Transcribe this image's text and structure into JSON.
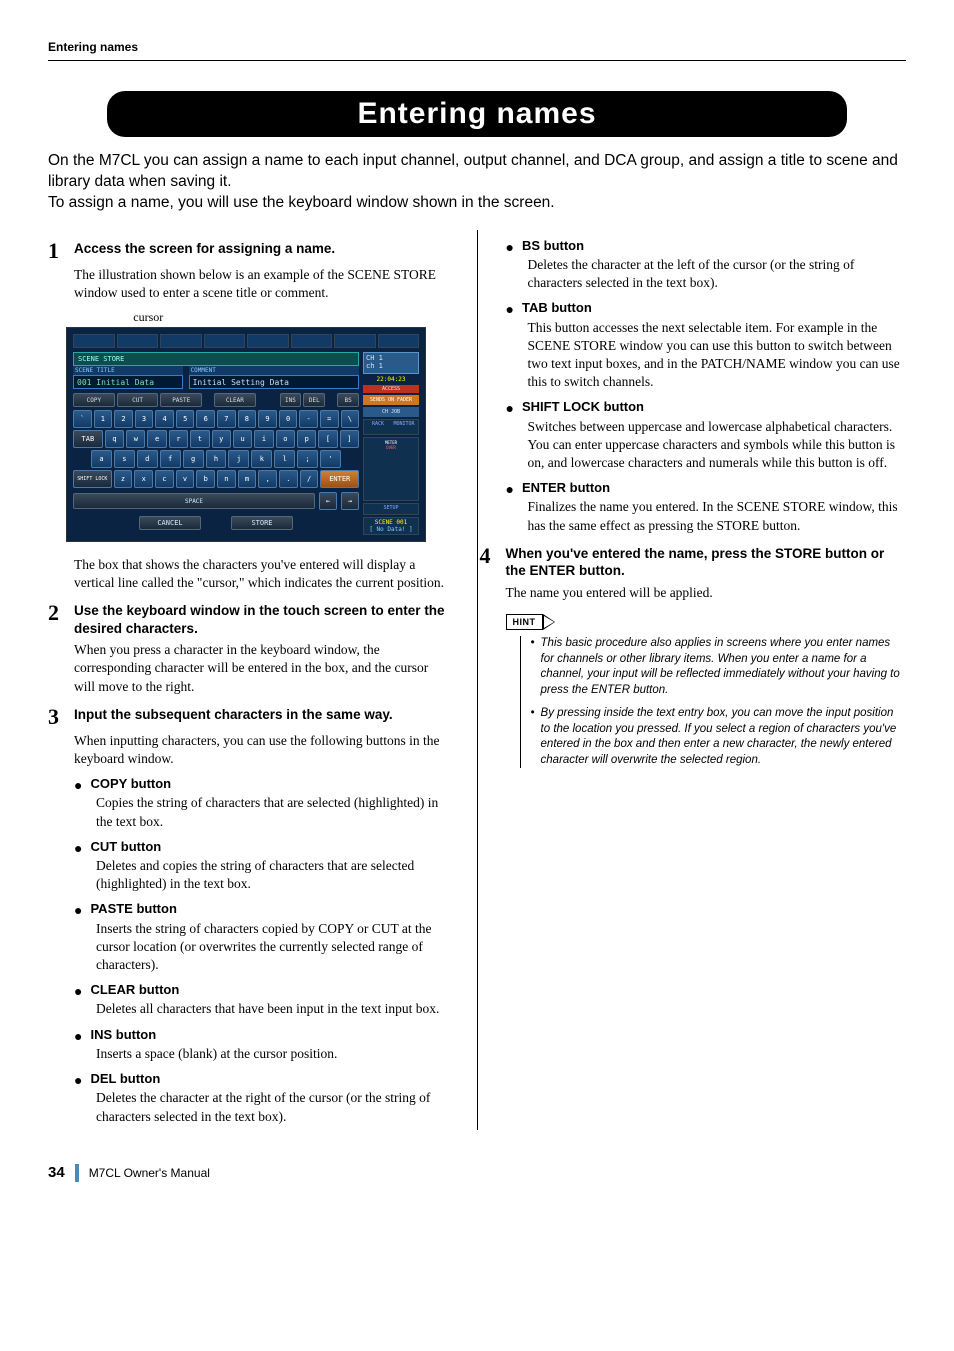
{
  "header": {
    "running_title": "Entering names"
  },
  "title": "Entering names",
  "intro": "On the M7CL you can assign a name to each input channel, output channel, and DCA group, and assign a title to scene and library data when saving it.\nTo assign a name, you will use the keyboard window shown in the screen.",
  "steps": {
    "s1": {
      "num": "1",
      "title": "Access the screen for assigning a name.",
      "body": "The illustration shown below is an example of the SCENE STORE window used to enter a scene title or comment.",
      "cursor_label": "cursor",
      "after": "The box that shows the characters you've entered will display a vertical line called the \"cursor,\" which indicates the current position."
    },
    "s2": {
      "num": "2",
      "title": "Use the keyboard window in the touch screen to enter the desired characters.",
      "body": "When you press a character in the keyboard window, the corresponding character will be entered in the box, and the cursor will move to the right."
    },
    "s3": {
      "num": "3",
      "title": "Input the subsequent characters in the same way.",
      "body": "When inputting characters, you can use the following buttons in the keyboard window."
    },
    "s4": {
      "num": "4",
      "title": "When you've entered the name, press the STORE button or the ENTER button.",
      "body": "The name you entered will be applied."
    }
  },
  "buttons": {
    "copy": {
      "t": "COPY button",
      "b": "Copies the string of characters that are selected (highlighted) in the text box."
    },
    "cut": {
      "t": "CUT button",
      "b": "Deletes and copies the string of characters that are selected (highlighted) in the text box."
    },
    "paste": {
      "t": "PASTE button",
      "b": "Inserts the string of characters copied by COPY or CUT at the cursor location (or overwrites the currently selected range of characters)."
    },
    "clear": {
      "t": "CLEAR button",
      "b": "Deletes all characters that have been input in the text input box."
    },
    "ins": {
      "t": "INS button",
      "b": "Inserts a space (blank) at the cursor position."
    },
    "del": {
      "t": "DEL button",
      "b": "Deletes the character at the right of the cursor (or the string of characters selected in the text box)."
    },
    "bs": {
      "t": "BS button",
      "b": "Deletes the character at the left of the cursor (or the string of characters selected in the text box)."
    },
    "tab": {
      "t": "TAB button",
      "b": "This button accesses the next selectable item. For example in the SCENE STORE window you can use this button to switch between two text input boxes, and in the PATCH/NAME window you can use this to switch channels."
    },
    "shift": {
      "t": "SHIFT LOCK button",
      "b": "Switches between uppercase and lowercase alphabetical characters. You can enter uppercase characters and symbols while this button is on, and lowercase characters and numerals while this button is off."
    },
    "enter": {
      "t": "ENTER button",
      "b": "Finalizes the name you entered. In the SCENE STORE window, this has the same effect as pressing the STORE button."
    }
  },
  "hint": {
    "label": "HINT",
    "h1": "This basic procedure also applies in screens where you enter names for channels or other library items. When you enter a name for a channel, your input will be reflected immediately without your having to press the ENTER button.",
    "h2": "By pressing inside the text entry box, you can move the input position to the location you pressed. If you select a region of characters you've entered in the box and then enter a new character, the newly entered character will overwrite the selected region."
  },
  "screenshot": {
    "store_label": "SCENE STORE",
    "scene_title_lbl": "SCENE TITLE",
    "scene_title_val": "001 Initial Data",
    "comment_lbl": "COMMENT",
    "comment_val": "Initial Setting Data",
    "btns": {
      "copy": "COPY",
      "cut": "CUT",
      "paste": "PASTE",
      "clear": "CLEAR",
      "ins": "INS",
      "del": "DEL",
      "bs": "BS"
    },
    "row_nums": [
      "`",
      "1",
      "2",
      "3",
      "4",
      "5",
      "6",
      "7",
      "8",
      "9",
      "0",
      "-",
      "=",
      "\\"
    ],
    "row_q": [
      "TAB",
      "q",
      "w",
      "e",
      "r",
      "t",
      "y",
      "u",
      "i",
      "o",
      "p",
      "[",
      "]"
    ],
    "row_a": [
      "a",
      "s",
      "d",
      "f",
      "g",
      "h",
      "j",
      "k",
      "l",
      ";",
      "'"
    ],
    "row_z": [
      "SHIFT LOCK",
      "z",
      "x",
      "c",
      "v",
      "b",
      "n",
      "m",
      ",",
      ".",
      "/",
      "ENTER"
    ],
    "space": "SPACE",
    "cancel": "CANCEL",
    "store": "STORE",
    "side": {
      "ch": "CH 1\nch 1",
      "time": "22:04:23",
      "access": "ACCESS",
      "sof": "SENDS ON FADER",
      "chjob": "CH JOB",
      "rack": "RACK",
      "monitor": "MONITOR",
      "meter": "METER",
      "over": "OVER",
      "setup": "SETUP",
      "scene": "SCENE 001",
      "nodata": "[ No Data! ]"
    }
  },
  "footer": {
    "page": "34",
    "manual": "M7CL  Owner's Manual"
  }
}
